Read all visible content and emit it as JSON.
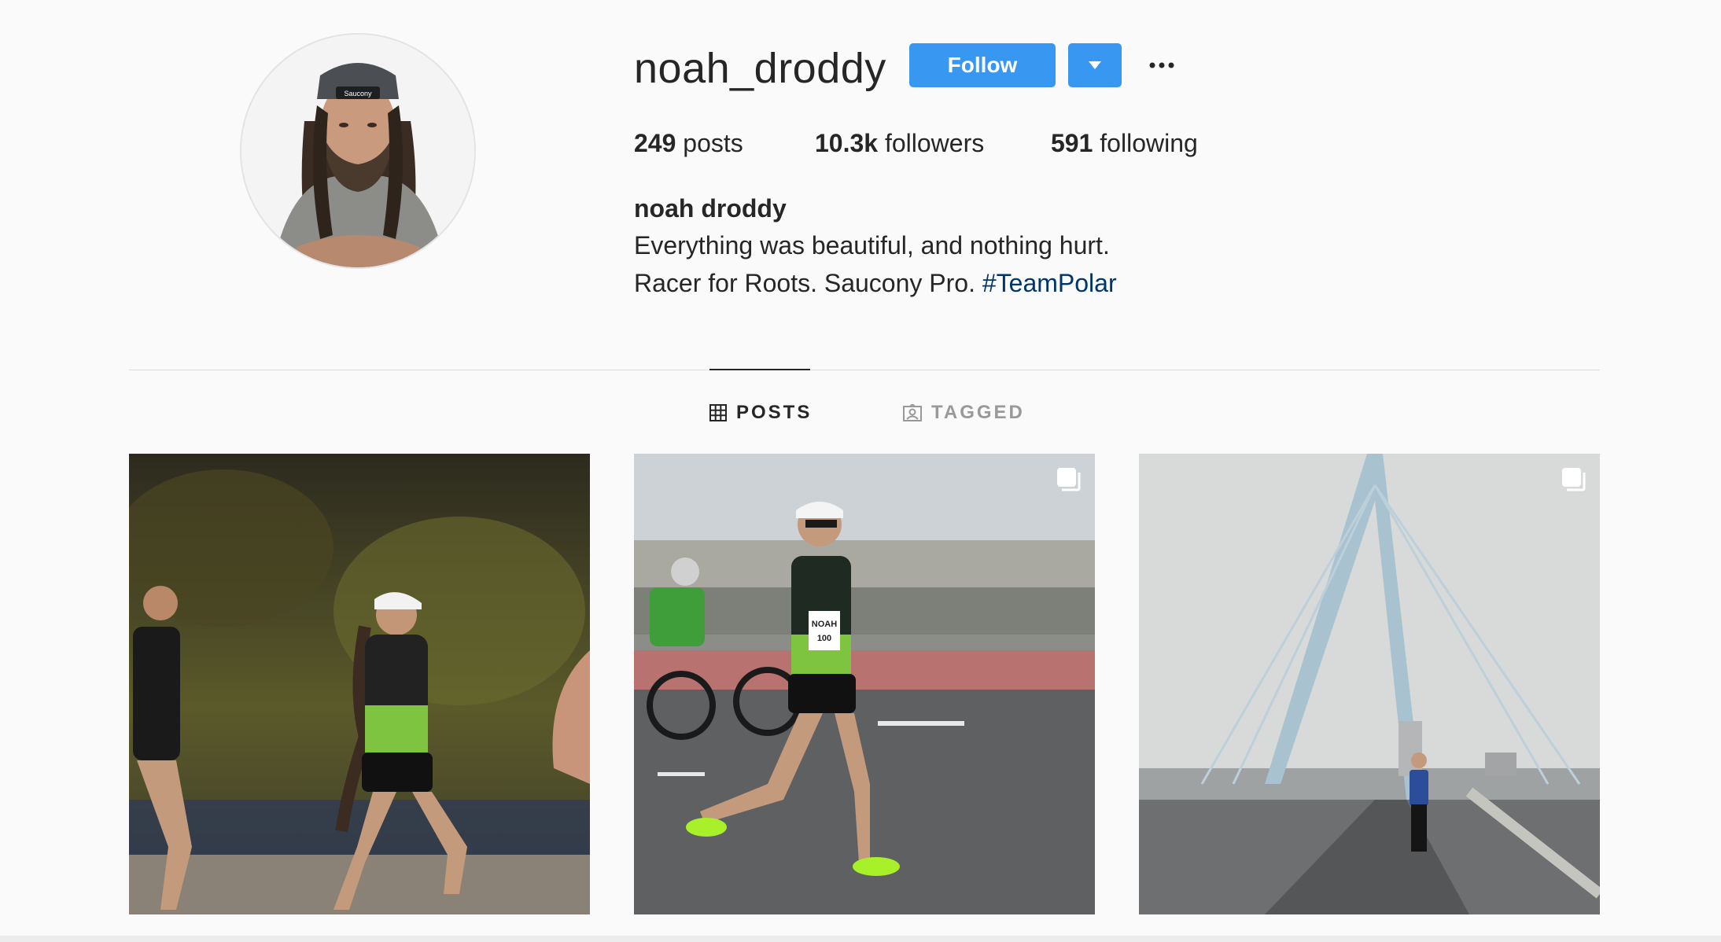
{
  "profile": {
    "username": "noah_droddy",
    "follow_label": "Follow",
    "full_name": "noah droddy",
    "bio_line1": "Everything was beautiful, and nothing hurt.",
    "bio_line2_text": "Racer for Roots. Saucony Pro. ",
    "bio_hashtag": "#TeamPolar",
    "cap_text": "Saucony"
  },
  "stats": {
    "posts_count": "249",
    "posts_label": " posts",
    "followers_count": "10.3k",
    "followers_label": " followers",
    "following_count": "591",
    "following_label": " following"
  },
  "tabs": {
    "posts_label": "POSTS",
    "tagged_label": "TAGGED"
  },
  "posts": {
    "post1_bib": "",
    "post2_bib_name": "NOAH",
    "post2_bib_number": "100"
  },
  "colors": {
    "accent": "#3897f0",
    "hashtag": "#003569",
    "text": "#262626",
    "muted": "#999999",
    "background": "#fafafa",
    "divider": "#dbdbdb"
  },
  "icons": {
    "dropdown": "chevron-down-icon",
    "more": "more-options-icon",
    "posts_tab": "grid-icon",
    "tagged_tab": "tagged-user-icon",
    "multi_post": "carousel-icon"
  }
}
